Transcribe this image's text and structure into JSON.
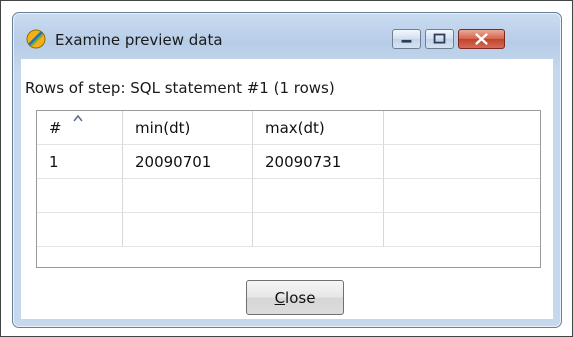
{
  "window": {
    "title": "Examine preview data",
    "icon": "spoon-icon"
  },
  "dialog": {
    "label": "Rows of step: SQL statement #1 (1 rows)",
    "table": {
      "columns": [
        "#",
        "min(dt)",
        "max(dt)",
        ""
      ],
      "rows": [
        [
          "1",
          "20090701",
          "20090731",
          ""
        ],
        [
          "",
          "",
          "",
          ""
        ],
        [
          "",
          "",
          "",
          ""
        ]
      ]
    },
    "close_button": {
      "mnemonic": "C",
      "rest": "lose"
    }
  }
}
